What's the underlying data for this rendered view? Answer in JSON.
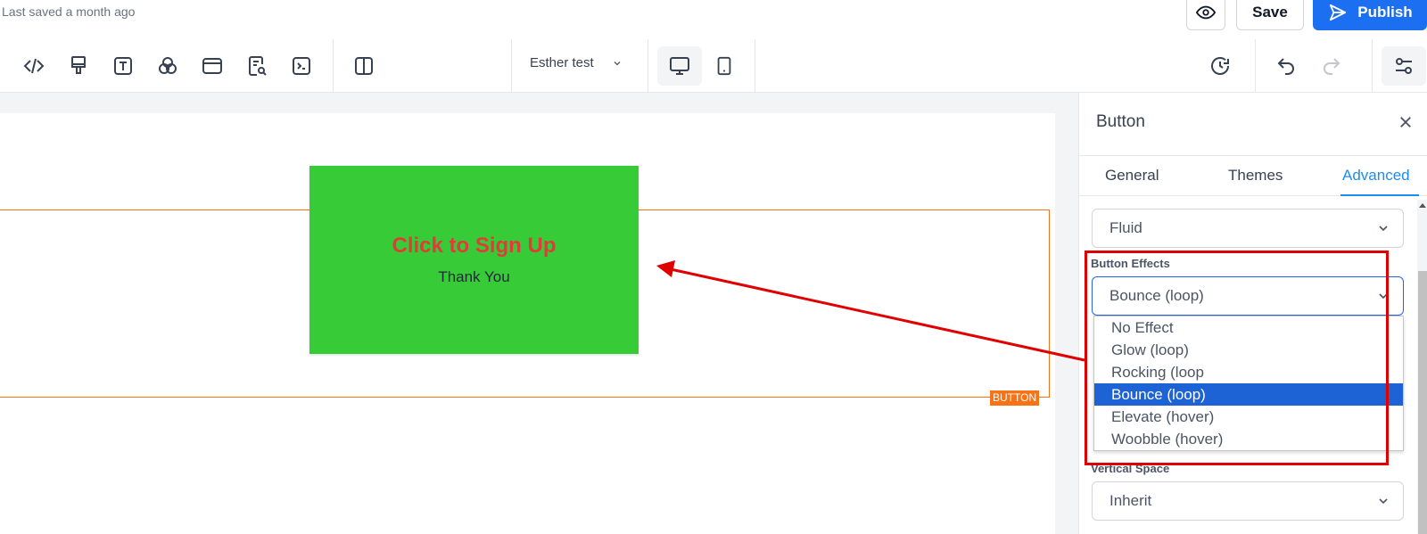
{
  "topbar": {
    "last_saved": "Last saved a month ago",
    "preview_icon": "eye-icon",
    "save_label": "Save",
    "publish_label": "Publish",
    "publish_icon": "send-icon"
  },
  "toolbar": {
    "icons": [
      "code-icon",
      "paint-brush-icon",
      "text-icon",
      "color-circles-icon",
      "layout-icon",
      "search-document-icon",
      "terminal-icon",
      "columns-icon"
    ],
    "page_name": "Esther test",
    "devices": [
      "desktop-icon",
      "tablet-icon"
    ],
    "right_icons": [
      "history-icon",
      "undo-icon",
      "redo-icon",
      "settings-sliders-icon"
    ]
  },
  "canvas": {
    "button_title": "Click to Sign Up",
    "button_subtitle": "Thank You",
    "selection_label": "BUTTON"
  },
  "panel": {
    "title": "Button",
    "tabs": [
      {
        "label": "General",
        "active": false
      },
      {
        "label": "Themes",
        "active": false
      },
      {
        "label": "Advanced",
        "active": true
      }
    ],
    "width_value": "Fluid",
    "effects_label": "Button Effects",
    "effects_value": "Bounce (loop)",
    "effects_options": [
      {
        "label": "No Effect",
        "selected": false
      },
      {
        "label": "Glow (loop)",
        "selected": false
      },
      {
        "label": "Rocking (loop",
        "selected": false
      },
      {
        "label": "Bounce (loop)",
        "selected": true
      },
      {
        "label": "Elevate (hover)",
        "selected": false
      },
      {
        "label": "Woobble (hover)",
        "selected": false
      }
    ],
    "vertical_space_label": "Vertical Space",
    "vertical_space_value": "Inherit"
  },
  "colors": {
    "accent": "#1d6ff2",
    "cta_background": "#38cb38",
    "cta_title": "#e33a3a",
    "selection": "#f97316",
    "annotation": "#e00000"
  }
}
